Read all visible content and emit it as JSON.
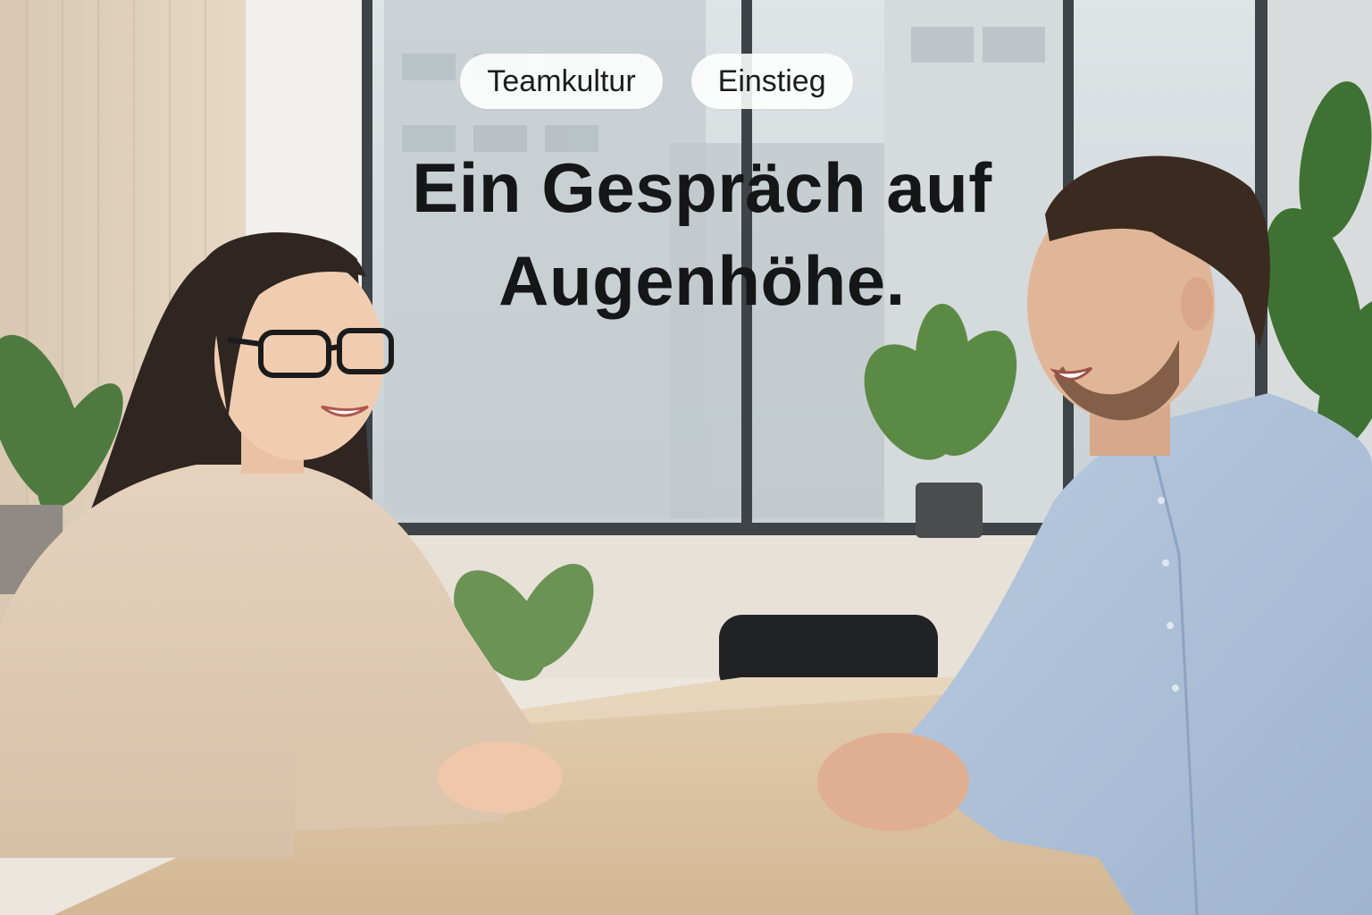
{
  "tags": [
    "Teamkultur",
    "Einstieg"
  ],
  "headline": {
    "line1": "Ein Gespräch auf",
    "line2": "Augenhöhe."
  }
}
